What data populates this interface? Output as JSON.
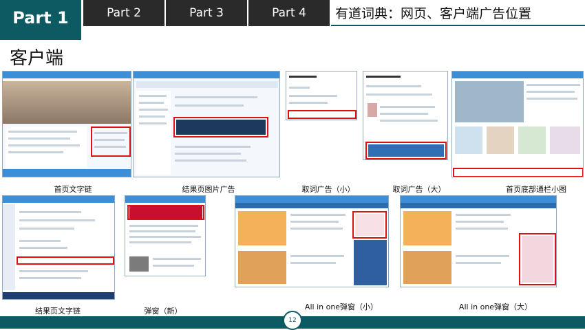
{
  "tabs": [
    {
      "label": "Part 1",
      "active": true
    },
    {
      "label": "Part 2",
      "active": false
    },
    {
      "label": "Part 3",
      "active": false
    },
    {
      "label": "Part 4",
      "active": false
    }
  ],
  "slide_title": "有道词典：网页、客户端广告位置",
  "section_heading": "客户端",
  "captions": [
    "首页文字链",
    "结果页图片广告",
    "取词广告（小）",
    "取词广告（大）",
    "首页底部通栏小图",
    "结果页文字链",
    "弹窗（新）",
    "All in one弹窗（小）",
    "All in one弹窗（大）"
  ],
  "page_number": "12",
  "colors": {
    "accent": "#0e5a63",
    "tab_dark": "#2a2a2a",
    "ad_highlight": "#dd1111",
    "app_blue": "#3c8fd6"
  }
}
